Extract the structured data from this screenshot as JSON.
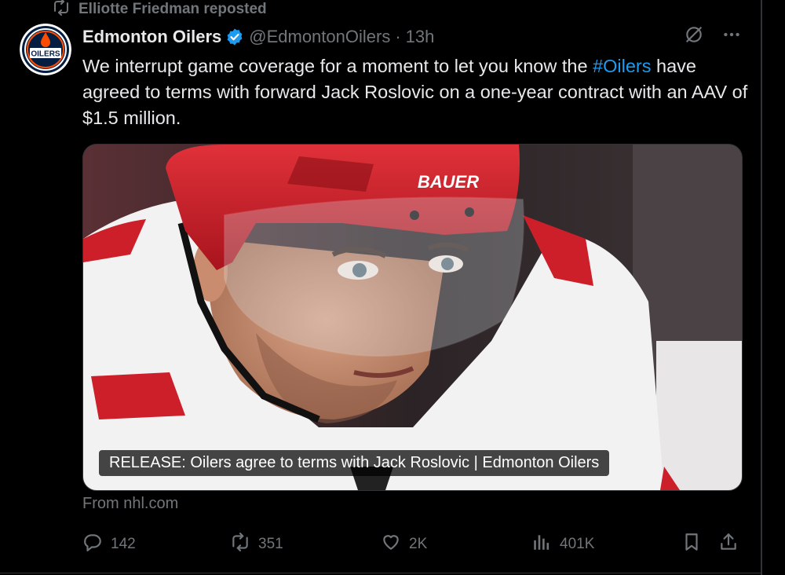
{
  "repost": {
    "label": "Elliotte Friedman reposted"
  },
  "author": {
    "name": "Edmonton Oilers",
    "handle": "@EdmontonOilers",
    "time": "13h",
    "avatar_text": "OILERS"
  },
  "tweet": {
    "text_before": "We interrupt game coverage for a moment to let you know the ",
    "hashtag": "#Oilers",
    "text_after": " have agreed to terms with forward Jack Roslovic on a one-year contract with an AAV of $1.5 million."
  },
  "media": {
    "caption": "RELEASE: Oilers agree to terms with Jack Roslovic | Edmonton Oilers",
    "helmet_brand": "BAUER"
  },
  "source": "From nhl.com",
  "actions": {
    "replies": "142",
    "reposts": "351",
    "likes": "2K",
    "views": "401K"
  },
  "colors": {
    "background": "#000000",
    "text": "#e7e9ea",
    "muted": "#71767b",
    "accent": "#1d9bf0",
    "border": "#2f3336"
  },
  "icons": [
    "repost-icon",
    "verified-badge-icon",
    "grok-icon",
    "more-icon",
    "reply-icon",
    "repost-icon",
    "like-icon",
    "views-icon",
    "bookmark-icon",
    "share-icon"
  ]
}
